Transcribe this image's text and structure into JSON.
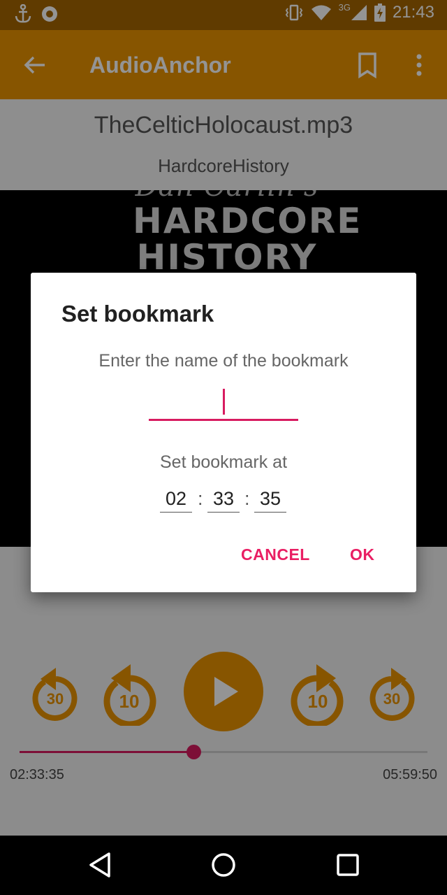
{
  "status_bar": {
    "time": "21:43",
    "network": "3G",
    "icons": [
      "anchor-icon",
      "record-icon",
      "vibrate-icon",
      "wifi-icon",
      "signal-icon",
      "battery-charging-icon"
    ]
  },
  "toolbar": {
    "title": "AudioAnchor",
    "icons": [
      "back-arrow-icon",
      "bookmark-icon",
      "overflow-menu-icon"
    ]
  },
  "track": {
    "title": "TheCelticHolocaust.mp3",
    "album": "HardcoreHistory",
    "cover_text": [
      "Dan Carlin's",
      "HARDCORE",
      "HISTORY"
    ]
  },
  "controls": {
    "rewind_long_label": "30",
    "rewind_short_label": "10",
    "forward_short_label": "10",
    "forward_long_label": "30",
    "accent_color": "#e99300"
  },
  "seekbar": {
    "current_time": "02:33:35",
    "total_time": "05:59:50",
    "progress": 0.426,
    "color": "#d81b60"
  },
  "dialog": {
    "title": "Set bookmark",
    "message": "Enter the name of the bookmark",
    "name_value": "",
    "position_label": "Set bookmark at",
    "hours": "02",
    "minutes": "33",
    "seconds": "35",
    "separator": ":",
    "cancel_label": "CANCEL",
    "ok_label": "OK",
    "accent_color": "#e91e63"
  },
  "nav_bar": {
    "icons": [
      "back-triangle-icon",
      "home-circle-icon",
      "recents-square-icon"
    ]
  }
}
